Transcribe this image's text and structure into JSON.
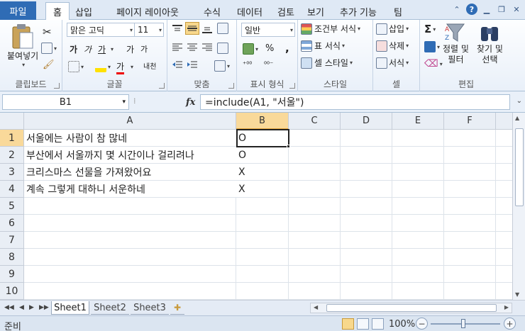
{
  "ribbon_tabs": {
    "file": "파일",
    "home": "홈",
    "insert": "삽입",
    "page_layout": "페이지 레이아웃",
    "formulas": "수식",
    "data": "데이터",
    "review": "검토",
    "view": "보기",
    "addins": "추가 기능",
    "team": "팀"
  },
  "clipboard": {
    "paste": "붙여넣기",
    "label": "클립보드"
  },
  "font": {
    "name": "맑은 고딕",
    "size": "11",
    "bold": "가",
    "italic": "가",
    "underline": "가",
    "grow": "가",
    "shrink": "가",
    "font_color": "가",
    "phonetic": "내천",
    "label": "글꼴"
  },
  "alignment": {
    "label": "맞춤"
  },
  "number": {
    "format": "일반",
    "percent": "%",
    "comma": ",",
    "label": "표시 형식"
  },
  "styles": {
    "conditional": "조건부 서식",
    "table": "표 서식",
    "cell": "셀 스타일",
    "label": "스타일"
  },
  "cells": {
    "insert": "삽입",
    "delete": "삭제",
    "format": "서식",
    "label": "셀"
  },
  "editing": {
    "sigma": "Σ",
    "sort": "정렬 및 필터",
    "sort_line1": "정렬 및",
    "sort_line2": "필터",
    "find_line1": "찾기 및",
    "find_line2": "선택",
    "label": "편집"
  },
  "formula_bar": {
    "name_box": "B1",
    "fx": "fx",
    "formula": "=include(A1, \"서울\")"
  },
  "columns": [
    "A",
    "B",
    "C",
    "D",
    "E",
    "F"
  ],
  "rows": [
    "1",
    "2",
    "3",
    "4",
    "5",
    "6",
    "7",
    "8",
    "9",
    "10"
  ],
  "cells_data": {
    "A1": "서울에는 사람이 참 많네",
    "A2": "부산에서 서울까지 몇 시간이나 걸리려나",
    "A3": "크리스마스 선물을 가져왔어요",
    "A4": "계속 그렇게 대하니 서운하네",
    "B1": "O",
    "B2": "O",
    "B3": "X",
    "B4": "X"
  },
  "sheets": [
    "Sheet1",
    "Sheet2",
    "Sheet3"
  ],
  "status": {
    "ready": "준비",
    "zoom": "100%"
  }
}
